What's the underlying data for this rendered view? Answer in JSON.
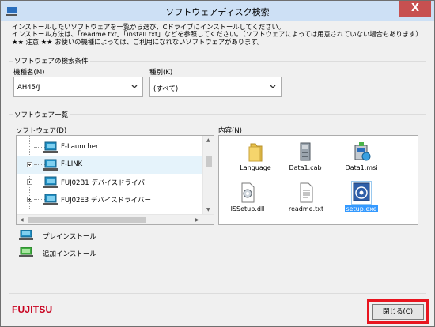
{
  "window": {
    "title": "ソフトウェアディスク検索",
    "close_glyph": "X"
  },
  "instructions": [
    "インストールしたいソフトウェアを一覧から選び、Cドライブにインストールしてください。",
    "インストール方法は、「readme.txt」「install.txt」などを参照してください。（ソフトウェアによっては用意されていない場合もあります）",
    "★★ 注意 ★★ お使いの機種によっては、ご利用になれないソフトウェアがあります。"
  ],
  "search": {
    "group_label": "ソフトウェアの検索条件",
    "model_label": "機種名(M)",
    "model_value": "AH45/J",
    "type_label": "種別(K)",
    "type_value": "(すべて)"
  },
  "list": {
    "group_label": "ソフトウェア一覧",
    "software_label": "ソフトウェア(D)",
    "content_label": "内容(N)",
    "tree_items": [
      {
        "label": "F-Launcher",
        "expandable": false
      },
      {
        "label": "F-LINK",
        "expandable": true
      },
      {
        "label": "FUJ02B1 デバイスドライバー",
        "expandable": true
      },
      {
        "label": "FUJ02E3 デバイスドライバー",
        "expandable": true
      }
    ],
    "files": [
      {
        "name": "Language",
        "icon": "folder-icon"
      },
      {
        "name": "Data1.cab",
        "icon": "cab-archive-icon"
      },
      {
        "name": "Data1.msi",
        "icon": "msi-installer-icon"
      },
      {
        "name": "ISSetup.dll",
        "icon": "dll-file-icon"
      },
      {
        "name": "readme.txt",
        "icon": "text-file-icon"
      },
      {
        "name": "setup.exe",
        "icon": "setup-exe-icon",
        "selected": true
      }
    ]
  },
  "legend": {
    "preinstall": "プレインストール",
    "additional": "追加インストール"
  },
  "brand": "FUJITSU",
  "close_button": "閉じる(C)",
  "colors": {
    "highlight": "#e8151f",
    "selection": "#3399ff",
    "brand": "#c8001e"
  }
}
